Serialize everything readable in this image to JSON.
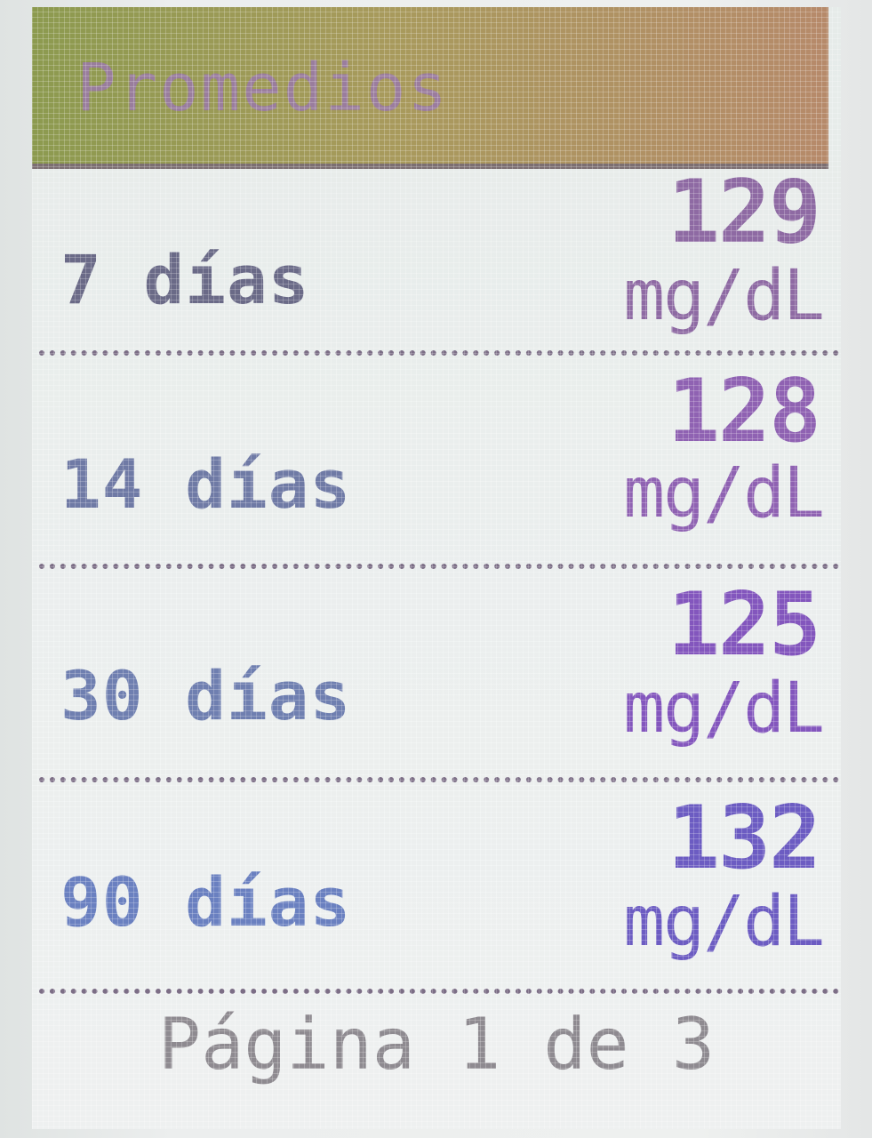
{
  "header": {
    "title": "Promedios"
  },
  "rows": [
    {
      "label": "7 días",
      "value": "129",
      "unit": "mg/dL",
      "label_color": "#6a6a87",
      "value_color": "#8e6aa3"
    },
    {
      "label": "14 días",
      "value": "128",
      "unit": "mg/dL",
      "label_color": "#6f7aa5",
      "value_color": "#8f62b2"
    },
    {
      "label": "30 días",
      "value": "125",
      "unit": "mg/dL",
      "label_color": "#6f7fb0",
      "value_color": "#8356bd"
    },
    {
      "label": "90 días",
      "value": "132",
      "unit": "mg/dL",
      "label_color": "#6a80c0",
      "value_color": "#6c5cc2"
    }
  ],
  "footer": {
    "page_text": "Página 1 de 3"
  },
  "colors": {
    "header_start": "#8c9a4f",
    "header_end": "#b68a6a",
    "divider": "#7c6e86",
    "footer_text": "#8e8a90"
  }
}
